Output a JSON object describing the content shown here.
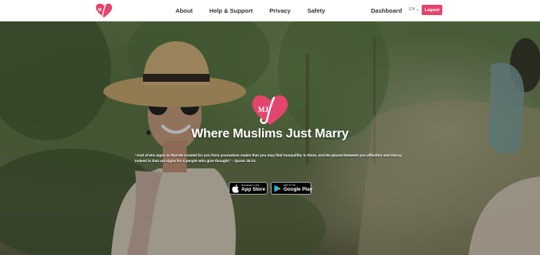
{
  "nav": {
    "logo_icon": "mj-heart-logo-icon",
    "links": [
      "About",
      "Help & Support",
      "Privacy",
      "Safety"
    ],
    "dashboard_label": "Dashboard",
    "language_label": "EN",
    "logout_label": "Logout"
  },
  "hero": {
    "logo_icon": "mj-heart-logo-icon",
    "logo_letters": "MJ",
    "title": "Where Muslims Just Marry",
    "quote": "\"And of His signs is that He created for you from yourselves mates that you may find tranquillity in them; and He placed between you affection and mercy. Indeed in that are signs for a people who give thought.\" - Quran 30:21",
    "badges": {
      "appstore": {
        "small": "Download on the",
        "big": "App Store",
        "icon": "apple-icon"
      },
      "googleplay": {
        "small": "GET IT ON",
        "big": "Google Play",
        "icon": "google-play-icon"
      }
    }
  },
  "colors": {
    "brand_pink": "#e4456d",
    "nav_background": "#ffffff",
    "nav_text": "#333333"
  }
}
